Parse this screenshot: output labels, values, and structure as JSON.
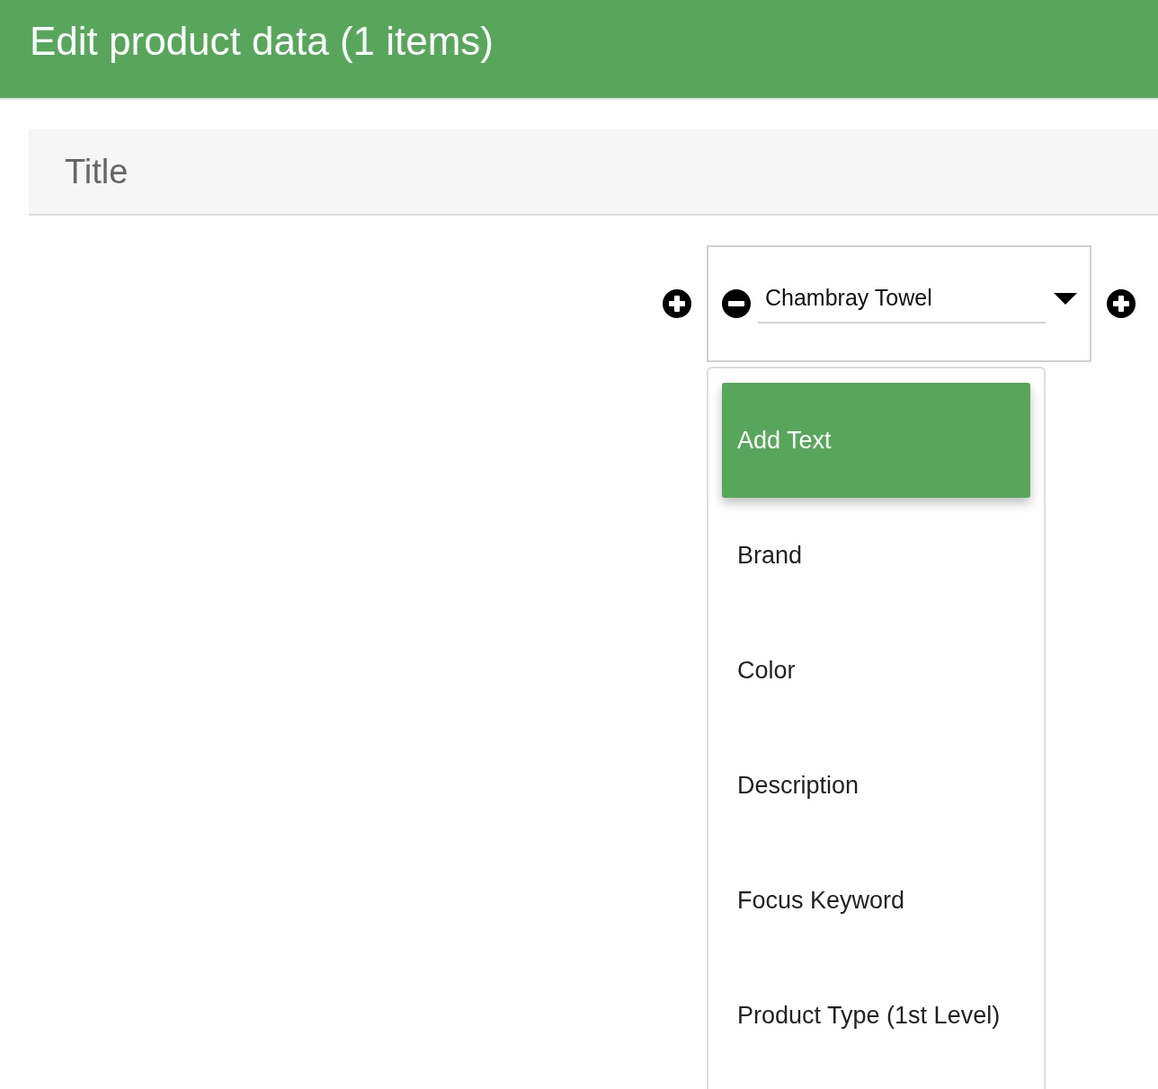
{
  "header": {
    "title": "Edit product data (1 items)"
  },
  "section": {
    "title": "Title"
  },
  "field": {
    "value": "Chambray Towel",
    "expanded": true
  },
  "menu": {
    "items": [
      {
        "label": "Add Text",
        "selected": true
      },
      {
        "label": "Brand",
        "selected": false
      },
      {
        "label": "Color",
        "selected": false
      },
      {
        "label": "Description",
        "selected": false
      },
      {
        "label": "Focus Keyword",
        "selected": false
      },
      {
        "label": "Product Type (1st Level)",
        "selected": false
      }
    ]
  }
}
